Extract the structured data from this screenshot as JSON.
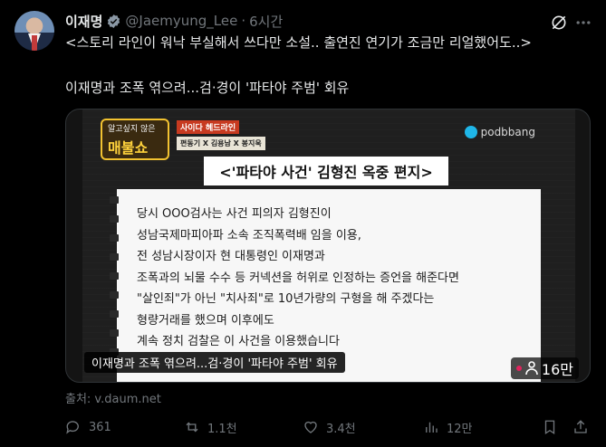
{
  "post": {
    "author_name": "이재명",
    "author_handle": "@Jaemyung_Lee",
    "separator": "·",
    "time": "6시간",
    "text_line1": "<스토리 라인이 워낙 부실해서 쓰다만 소설.. 출연진 연기가 조금만 리얼했어도..>",
    "text_line2": "이재명과 조폭 엮으려...검·경이 '파타야 주범' 회유"
  },
  "media": {
    "show_logo_top": "알고싶지 않은",
    "show_logo_main": "매불쇼",
    "segment_tag": "사이다 헤드라인",
    "hosts": "편동기 X 김용남 X 봉지욱",
    "brand": "podbbang",
    "title": "<'파타야 사건' 김형진 옥중 편지>",
    "letter_lines": [
      "당시 OOO검사는 사건 피의자 김형진이",
      "성남국제마피아파 소속 조직폭력배 임을 이용,",
      "전 성남시장이자 현 대통령인 이재명과",
      "조폭과의 뇌물 수수 등 커넥션을 허위로 인정하는 증언을 해준다면",
      "\"살인죄\"가 아닌 \"치사죄\"로 10년가량의 구형을 해 주겠다는",
      "형량거래를 했으며 이후에도",
      "계속 정치 검찰은 이 사건을 이용했습니다"
    ],
    "caption": "이재명과 조폭 엮으려...검·경이 '파타야 주범' 회유",
    "views": "16만"
  },
  "source": "출처: v.daum.net",
  "actions": {
    "replies": "361",
    "reposts": "1.1천",
    "likes": "3.4천",
    "views": "12만"
  },
  "colors": {
    "background": "#000000",
    "text": "#e7e9ea",
    "muted": "#71767b",
    "verified": "#8b98a5"
  }
}
